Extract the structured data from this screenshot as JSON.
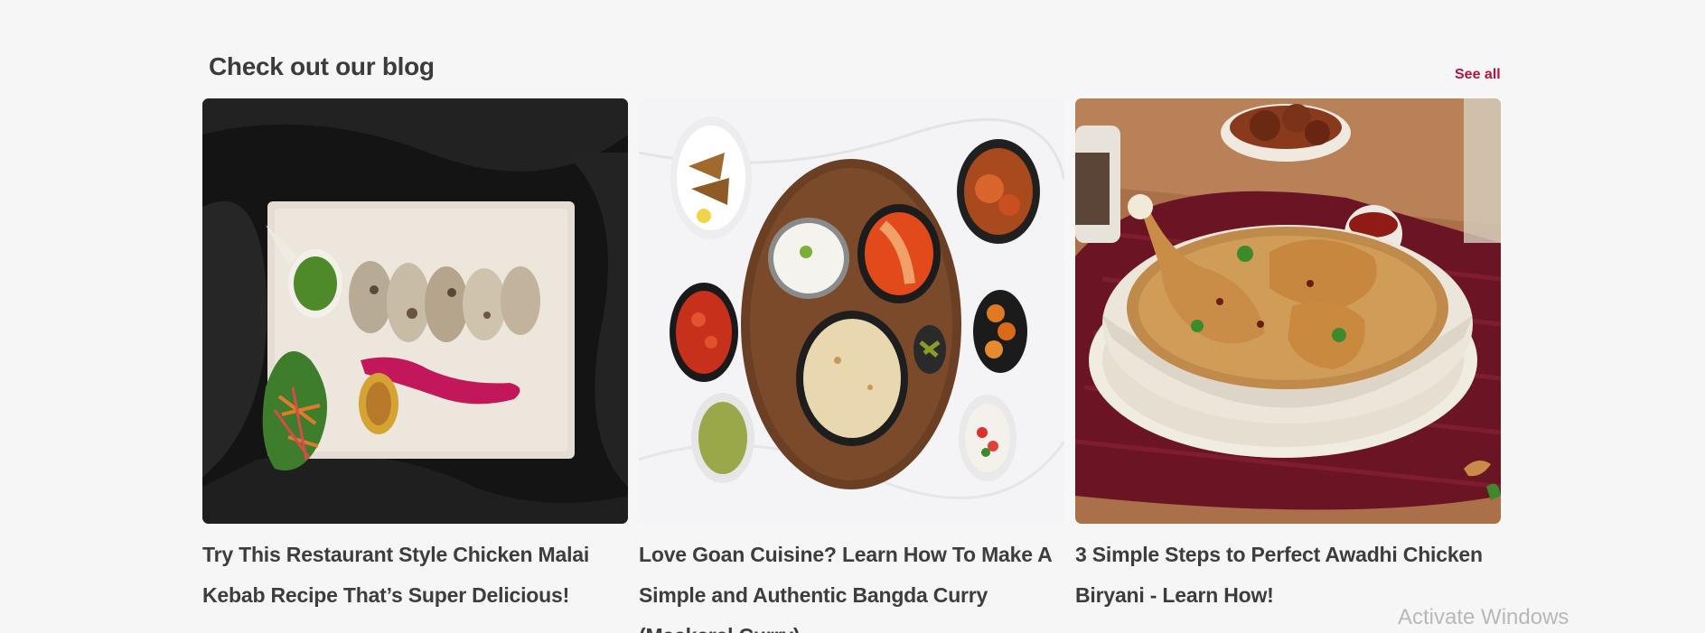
{
  "section": {
    "title": "Check out our blog",
    "see_all_label": "See all"
  },
  "posts": [
    {
      "title": "Try This Restaurant Style Chicken Malai Kebab Recipe That’s Super Delicious!",
      "image": "chicken-malai-kebab-photo"
    },
    {
      "title": "Love Goan Cuisine? Learn How To Make A Simple and Authentic Bangda Curry (Mackerel Curry)",
      "image": "goan-thali-photo"
    },
    {
      "title": "3 Simple Steps to Perfect Awadhi Chicken Biryani - Learn How!",
      "image": "awadhi-chicken-biryani-photo"
    }
  ],
  "watermark": "Activate Windows",
  "colors": {
    "background": "#f6f6f6",
    "accent": "#b3153f",
    "text": "#3d3d3d"
  }
}
